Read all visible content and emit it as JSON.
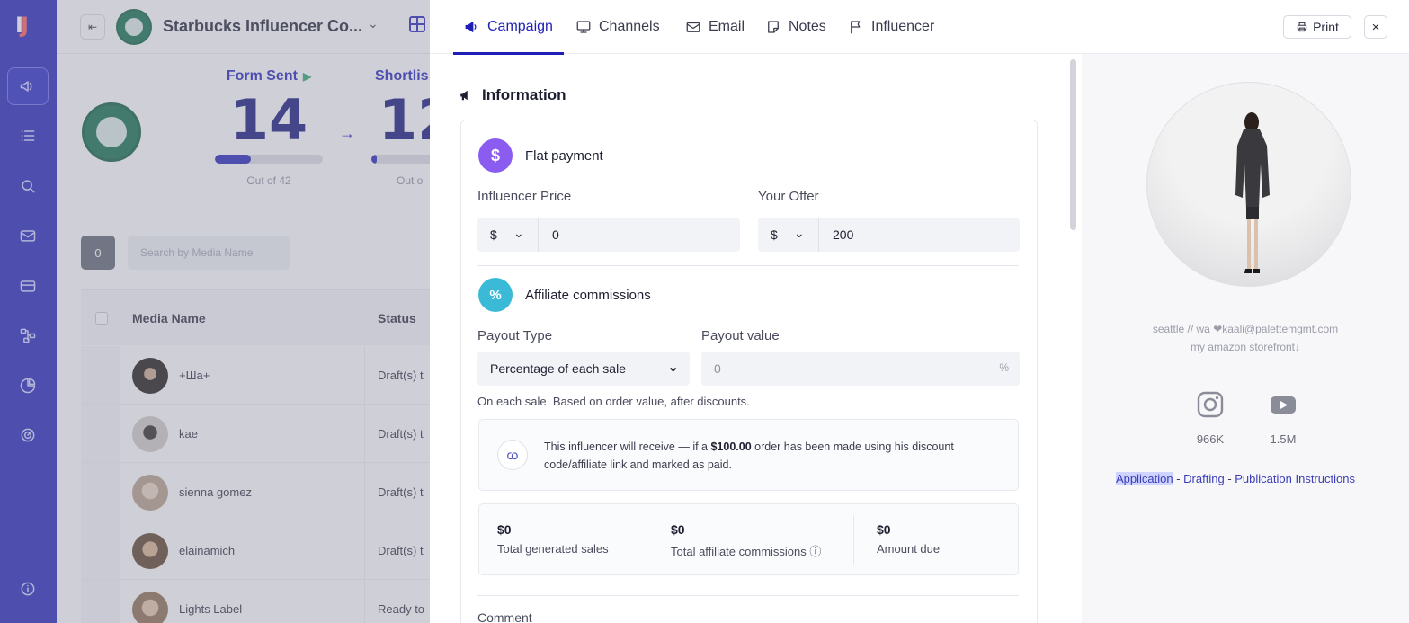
{
  "nav": {
    "logo": "IJ",
    "items": [
      {
        "icon": "megaphone-icon",
        "active": true
      },
      {
        "icon": "list-icon",
        "active": false
      },
      {
        "icon": "search-icon",
        "active": false
      },
      {
        "icon": "mail-icon",
        "active": false
      },
      {
        "icon": "credit-card-icon",
        "active": false
      },
      {
        "icon": "workflow-icon",
        "active": false
      },
      {
        "icon": "pie-chart-icon",
        "active": false
      },
      {
        "icon": "radar-icon",
        "active": false
      }
    ],
    "bottom_icon": "info-icon"
  },
  "background": {
    "campaign_title": "Starbucks Influencer Co...",
    "stages": [
      {
        "label": "Form Sent",
        "value": "14",
        "progress": 0.33,
        "outof": "Out of 42"
      },
      {
        "label": "Shortlis",
        "value": "12",
        "progress": 0.05,
        "outof": "Out o"
      }
    ],
    "search": {
      "count": "0",
      "placeholder": "Search by Media Name"
    },
    "table": {
      "columns": [
        "Media Name",
        "Status"
      ],
      "rows": [
        {
          "name": "+Ша+",
          "status": "Draft(s) t"
        },
        {
          "name": "kae",
          "status": "Draft(s) t"
        },
        {
          "name": "sienna gomez",
          "status": "Draft(s) t"
        },
        {
          "name": "elainamich",
          "status": "Draft(s) t"
        },
        {
          "name": "Lights Label",
          "status": "Ready to"
        }
      ]
    }
  },
  "drawer": {
    "tabs": [
      {
        "label": "Campaign",
        "icon": "megaphone-icon",
        "active": true
      },
      {
        "label": "Channels",
        "icon": "monitor-icon",
        "active": false
      },
      {
        "label": "Email",
        "icon": "mail-icon",
        "active": false
      },
      {
        "label": "Notes",
        "icon": "note-icon",
        "active": false
      },
      {
        "label": "Influencer",
        "icon": "flag-icon",
        "active": false
      }
    ],
    "print_label": "Print",
    "close_label": "×",
    "section_title": "Information",
    "flat": {
      "title": "Flat payment",
      "icon_char": "$",
      "influencer_price_label": "Influencer Price",
      "influencer_price_currency": "$",
      "influencer_price_value": "0",
      "your_offer_label": "Your Offer",
      "your_offer_currency": "$",
      "your_offer_value": "200"
    },
    "affiliate": {
      "title": "Affiliate commissions",
      "icon_char": "%",
      "payout_type_label": "Payout Type",
      "payout_type_value": "Percentage of each sale",
      "payout_value_label": "Payout value",
      "payout_value": "0",
      "payout_suffix": "%",
      "hint": "On each sale. Based on order value, after discounts.",
      "info_pre": "This influencer will receive — if a ",
      "info_amount": "$100.00",
      "info_post": " order has been made using his discount code/affiliate link and marked as paid.",
      "stats": [
        {
          "value": "$0",
          "label": "Total generated sales"
        },
        {
          "value": "$0",
          "label": "Total affiliate commissions ⓘ"
        },
        {
          "value": "$0",
          "label": "Amount due"
        }
      ]
    },
    "comment_label": "Comment",
    "profile": {
      "bio_line1": "seattle // wa ❤kaali@palettemgmt.com",
      "bio_line2": "my amazon storefront↓",
      "instagram_count": "966K",
      "youtube_count": "1.5M",
      "link_application": "Application",
      "link_drafting": "Drafting",
      "link_publication": "Publication Instructions",
      "link_sep": " - "
    }
  }
}
